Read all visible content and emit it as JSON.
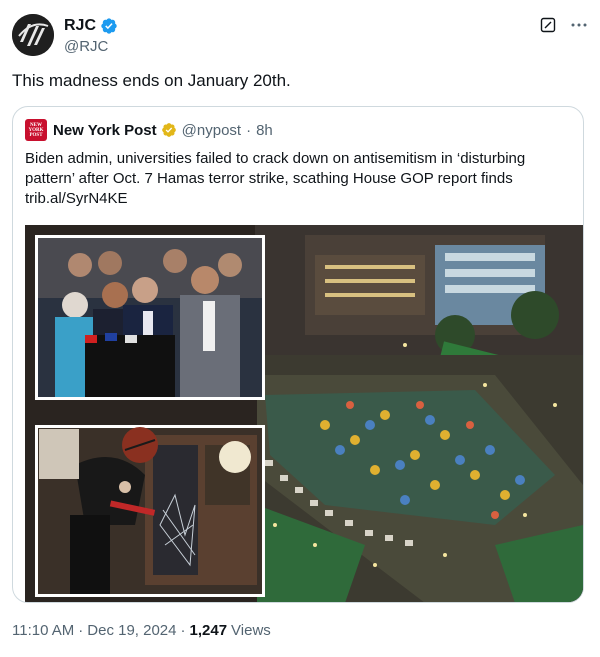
{
  "author": {
    "display_name": "RJC",
    "handle": "@RJC",
    "verified_icon": "verified-badge-icon",
    "avatar_icon": "rjc-logo-icon"
  },
  "tweet": {
    "text": "This madness ends on January 20th."
  },
  "quote": {
    "source_name": "New York Post",
    "logo_text": "NEW YORK POST",
    "handle": "@nypost",
    "separator": "·",
    "age": "8h",
    "body": "Biden admin, universities failed to crack down on antisemitism in ‘disturbing pattern’ after Oct. 7 Hamas terror strike, scathing House GOP report finds",
    "link": "trib.al/SyrN4KE",
    "media_description_icon": "news-photo-collage"
  },
  "footer": {
    "time": "11:10 AM",
    "sep1": "·",
    "date": "Dec 19, 2024",
    "sep2": "·",
    "views_count": "1,247",
    "views_label": "Views"
  },
  "colors": {
    "text": "#0f1419",
    "secondary": "#536471",
    "border": "#cfd9de",
    "verified_blue": "#1d9bf0",
    "verified_gold": "#e2b719",
    "nypost_red": "#c8102e"
  }
}
